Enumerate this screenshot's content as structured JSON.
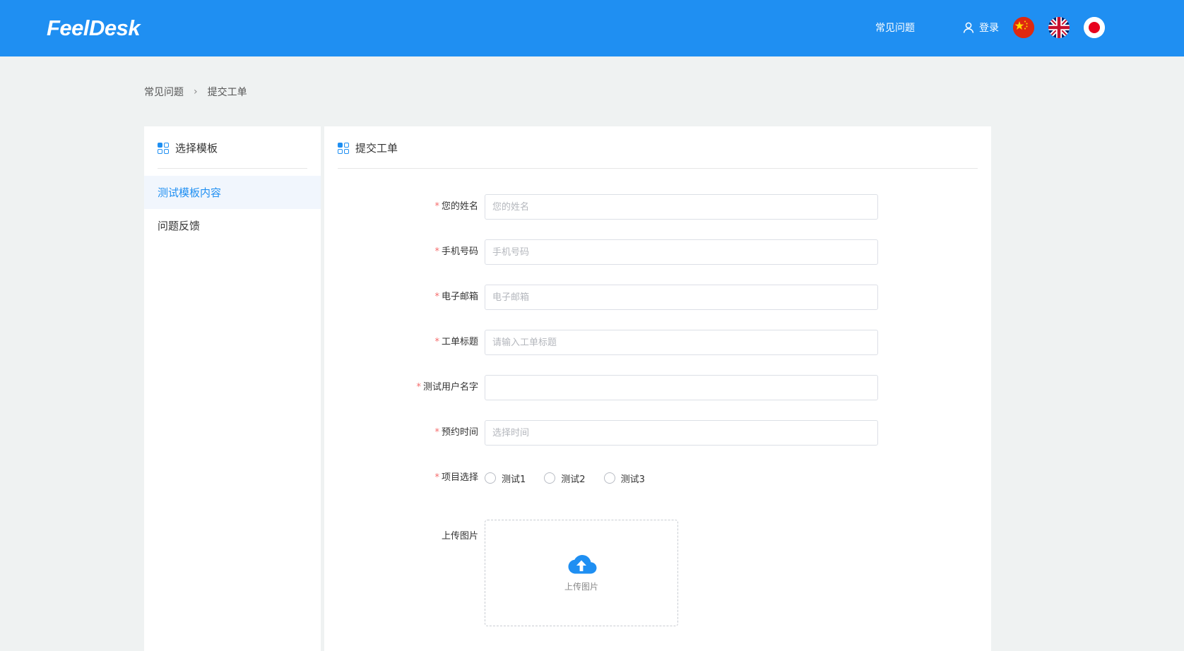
{
  "header": {
    "logo": "FeelDesk",
    "nav_faq": "常见问题",
    "login": "登录",
    "colors": {
      "header_bg": "#1f8ff2",
      "accent": "#1f8ff2",
      "required": "#f56c6c"
    }
  },
  "breadcrumb": [
    "常见问题",
    "提交工单"
  ],
  "left": {
    "title": "选择模板",
    "items": [
      {
        "label": "测试模板内容",
        "active": true
      },
      {
        "label": "问题反馈",
        "active": false
      }
    ]
  },
  "right": {
    "title": "提交工单",
    "fields": [
      {
        "label": "您的姓名",
        "placeholder": "您的姓名",
        "required": true
      },
      {
        "label": "手机号码",
        "placeholder": "手机号码",
        "required": true
      },
      {
        "label": "电子邮箱",
        "placeholder": "电子邮箱",
        "required": true
      },
      {
        "label": "工单标题",
        "placeholder": "请输入工单标题",
        "required": true
      },
      {
        "label": "测试用户名字",
        "placeholder": "",
        "required": true
      },
      {
        "label": "预约时间",
        "placeholder": "选择时间",
        "required": true
      }
    ],
    "project": {
      "label": "项目选择",
      "required": true,
      "options": [
        "测试1",
        "测试2",
        "测试3"
      ]
    },
    "upload": {
      "label": "上传图片",
      "button_text": "上传图片"
    }
  }
}
